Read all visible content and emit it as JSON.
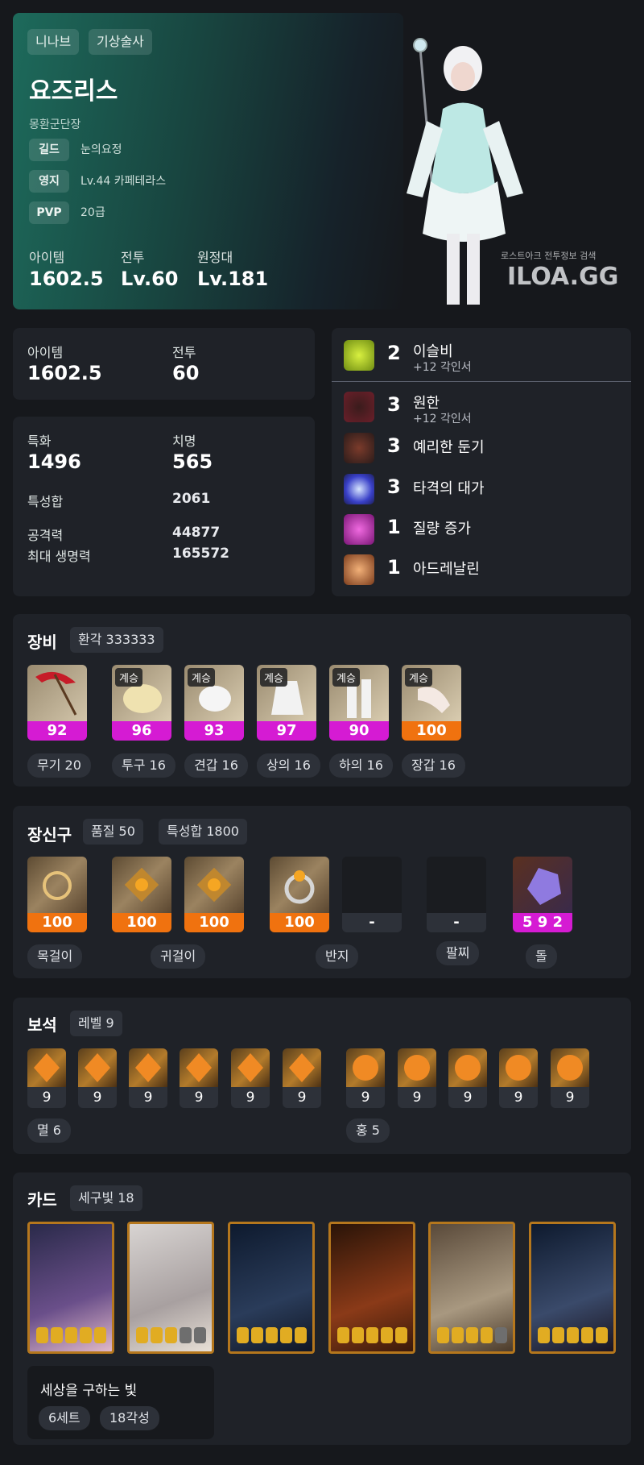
{
  "profile": {
    "server": "니나브",
    "class": "기상술사",
    "name": "요즈리스",
    "title": "몽환군단장",
    "rows": [
      {
        "label": "길드",
        "value": "눈의요정"
      },
      {
        "label": "영지",
        "value": "Lv.44 카페테라스"
      },
      {
        "label": "PVP",
        "value": "20급"
      }
    ],
    "stats": [
      {
        "label": "아이템",
        "value": "1602.5"
      },
      {
        "label": "전투",
        "value": "Lv.60"
      },
      {
        "label": "원정대",
        "value": "Lv.181"
      }
    ],
    "watermark_small": "로스트아크 전투정보 검색",
    "watermark_big": "ILOA.GG"
  },
  "summary": {
    "item_label": "아이템",
    "item_value": "1602.5",
    "battle_label": "전투",
    "battle_value": "60"
  },
  "combat": {
    "spec_label": "특화",
    "spec_value": "1496",
    "crit_label": "치명",
    "crit_value": "565",
    "sum_label": "특성합",
    "sum_value": "2061",
    "atk_label": "공격력",
    "atk_value": "44877",
    "hp_label": "최대 생명력",
    "hp_value": "165572"
  },
  "engravings": [
    {
      "level": "2",
      "name": "이슬비",
      "sub": "+12 각인서",
      "color": "#9dbf1c"
    },
    {
      "level": "3",
      "name": "원한",
      "sub": "+12 각인서",
      "color": "#7a2530"
    },
    {
      "level": "3",
      "name": "예리한 둔기",
      "sub": "",
      "color": "#6b3a2a"
    },
    {
      "level": "3",
      "name": "타격의 대가",
      "sub": "",
      "color": "#4b53d8"
    },
    {
      "level": "1",
      "name": "질량 증가",
      "sub": "",
      "color": "#b12aa8"
    },
    {
      "level": "1",
      "name": "아드레날린",
      "sub": "",
      "color": "#a05a2a"
    }
  ],
  "equipment": {
    "title": "장비",
    "chip": "환각 333333",
    "items": [
      {
        "quality": "92",
        "badge": "",
        "label": "무기 20",
        "bar": "pink"
      },
      {
        "quality": "96",
        "badge": "계승",
        "label": "투구 16",
        "bar": "pink"
      },
      {
        "quality": "93",
        "badge": "계승",
        "label": "견갑 16",
        "bar": "pink"
      },
      {
        "quality": "97",
        "badge": "계승",
        "label": "상의 16",
        "bar": "pink"
      },
      {
        "quality": "90",
        "badge": "계승",
        "label": "하의 16",
        "bar": "pink"
      },
      {
        "quality": "100",
        "badge": "계승",
        "label": "장갑 16",
        "bar": "orange"
      }
    ]
  },
  "accessories": {
    "title": "장신구",
    "chip1": "품질 50",
    "chip2": "특성합 1800",
    "items": [
      {
        "quality": "100",
        "bar": "orange"
      },
      {
        "quality": "100",
        "bar": "orange"
      },
      {
        "quality": "100",
        "bar": "orange"
      },
      {
        "quality": "100",
        "bar": "orange"
      },
      {
        "quality": "-",
        "bar": "grey"
      },
      {
        "quality": "-",
        "bar": "grey"
      },
      {
        "quality": "5 9 2",
        "bar": "pink"
      }
    ],
    "labels": [
      "목걸이",
      "귀걸이",
      "반지",
      "팔찌",
      "돌"
    ]
  },
  "gems": {
    "title": "보석",
    "chip": "레벨 9",
    "levels": [
      "9",
      "9",
      "9",
      "9",
      "9",
      "9",
      "9",
      "9",
      "9",
      "9",
      "9"
    ],
    "group1": "멸 6",
    "group2": "홍 5"
  },
  "cards": {
    "title": "카드",
    "chip": "세구빛 18",
    "set_name": "세상을 구하는 빛",
    "set_count": "6세트",
    "awaken": "18각성",
    "colors": [
      "#5a4a8a",
      "#c9c2c8",
      "#1d3450",
      "#5a2a14",
      "#8a7a66",
      "#2b3a52"
    ],
    "stars": [
      5,
      3,
      5,
      5,
      4,
      5
    ]
  }
}
